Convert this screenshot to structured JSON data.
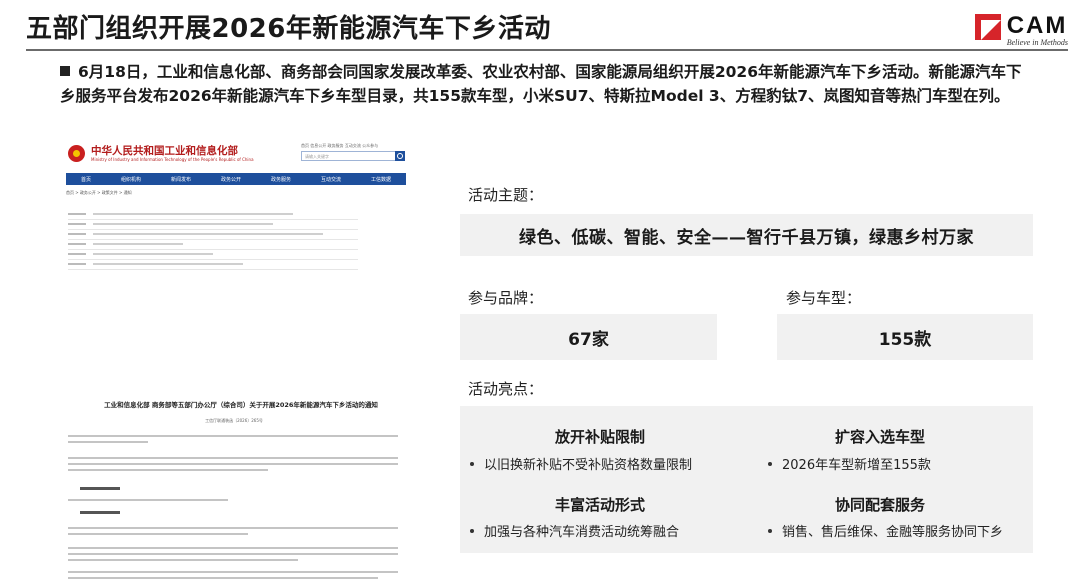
{
  "header": {
    "title": "五部门组织开展2026年新能源汽车下乡活动",
    "logo_text": "CAM",
    "logo_tagline": "Believe in Methods"
  },
  "bullet": {
    "line1": "6月18日，工业和信息化部、商务部会同国家发展改革委、农业农村部、国家能源局组织开展2026年新能源汽车下乡活动。新能源汽车下",
    "line2": "乡服务平台发布2026年新能源汽车下乡车型目录，共155款车型，小米SU7、特斯拉Model 3、方程豹钛7、岚图知音等热门车型在列。"
  },
  "document": {
    "org_name": "中华人民共和国工业和信息化部",
    "org_name_en": "Ministry of Industry and Information Technology of the People's Republic of China",
    "top_links": "首页  信息公开  政务服务  互动交流  公众参与",
    "search_placeholder": "请输入关键字",
    "nav": [
      "首页",
      "组织机构",
      "新闻发布",
      "政务公开",
      "政务服务",
      "互动交流",
      "工信数据"
    ],
    "breadcrumb": "首页 > 政务公开 > 政策文件 > 通知",
    "heading": "工业和信息化部 商务部等五部门办公厅（综合司）关于开展2026年新能源汽车下乡活动的通知",
    "doc_number": "工信厅联通装函〔2026〕265号"
  },
  "theme": {
    "label": "活动主题：",
    "text": "绿色、低碳、智能、安全——智行千县万镇，绿惠乡村万家"
  },
  "brands": {
    "label": "参与品牌：",
    "value": "67家"
  },
  "models": {
    "label": "参与车型：",
    "value": "155款"
  },
  "highlights": {
    "label": "活动亮点：",
    "items": [
      {
        "title": "放开补贴限制",
        "detail": "以旧换新补贴不受补贴资格数量限制"
      },
      {
        "title": "扩容入选车型",
        "detail": "2026年车型新增至155款"
      },
      {
        "title": "丰富活动形式",
        "detail": "加强与各种汽车消费活动统筹融合"
      },
      {
        "title": "协同配套服务",
        "detail": "销售、售后维保、金融等服务协同下乡"
      }
    ]
  },
  "colors": {
    "logo_red": "#d6242a",
    "doc_nav_blue": "#1e4f9c",
    "panel_gray": "#f1f1f1"
  }
}
